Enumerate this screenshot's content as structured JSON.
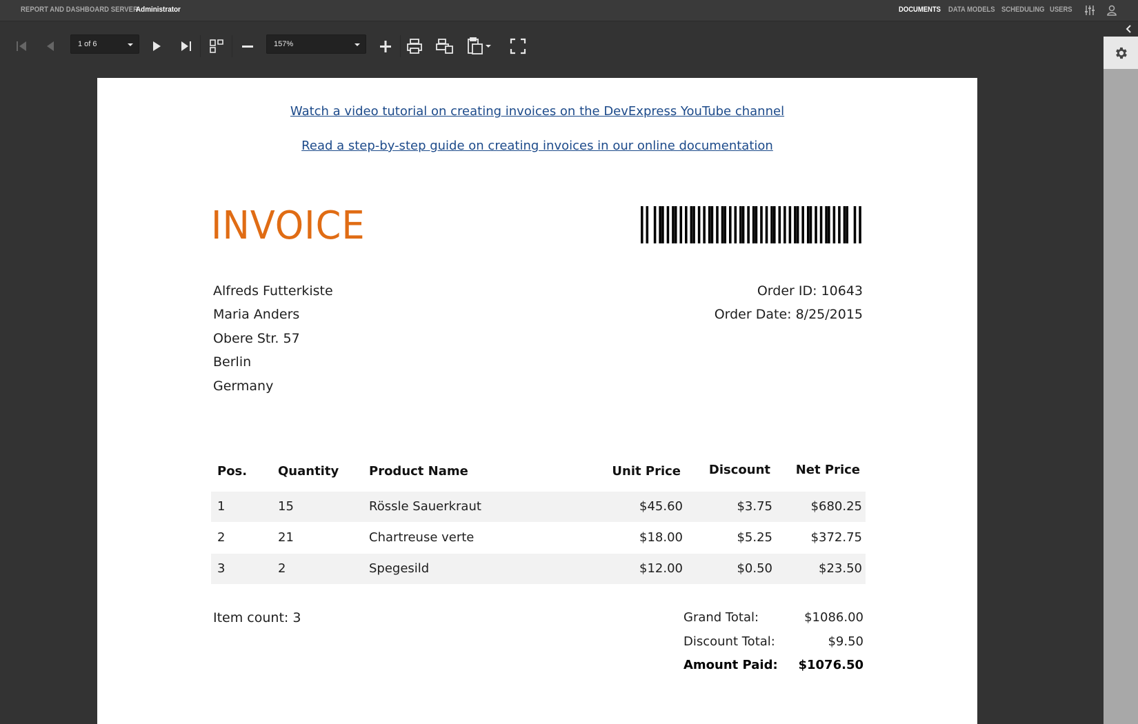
{
  "app": {
    "title": "REPORT AND DASHBOARD SERVER",
    "user": "Administrator",
    "nav": [
      "DOCUMENTS",
      "DATA MODELS",
      "SCHEDULING",
      "USERS"
    ],
    "active_nav": "DOCUMENTS"
  },
  "toolbar": {
    "page_selector": "1 of 6",
    "zoom": "157%",
    "buttons": [
      "first-page-icon",
      "prev-page-icon",
      "next-page-icon",
      "last-page-icon",
      "multipage-toggle-icon",
      "zoom-out-icon",
      "zoom-in-icon",
      "print-icon",
      "print-page-icon",
      "export-icon",
      "fullscreen-icon"
    ]
  },
  "document": {
    "links": [
      "Watch a video tutorial on creating invoices on the DevExpress YouTube channel",
      "Read a step-by-step guide on creating invoices in our online documentation"
    ],
    "title": "INVOICE",
    "barcode_bars": [
      1,
      0,
      1,
      0,
      0,
      1,
      0,
      1,
      1,
      0,
      1,
      0,
      1,
      1,
      0,
      1,
      0,
      1,
      0,
      1,
      1,
      0,
      1,
      0,
      1,
      0,
      1,
      1,
      0,
      1,
      0,
      1,
      1,
      0,
      1,
      0,
      1,
      0,
      1,
      1,
      0,
      1,
      0,
      1,
      1,
      0,
      1,
      0,
      1,
      0,
      1,
      1,
      0,
      1,
      0,
      1,
      0,
      1,
      0,
      1,
      1,
      0,
      1,
      0,
      1,
      1,
      0,
      1,
      0,
      1,
      0,
      1,
      1,
      0,
      1,
      0,
      1,
      0,
      1,
      1,
      0,
      0,
      1,
      0,
      1
    ],
    "customer": {
      "company": "Alfreds Futterkiste",
      "contact": "Maria Anders",
      "street": "Obere Str. 57",
      "city": "Berlin",
      "country": "Germany"
    },
    "order": {
      "id": "Order ID: 10643",
      "date": "Order Date: 8/25/2015"
    },
    "table": {
      "headers": {
        "pos": "Pos.",
        "quantity": "Quantity",
        "product": "Product Name",
        "unit_price": "Unit Price",
        "discount": "Discount",
        "net_price": "Net Price"
      },
      "rows": [
        {
          "pos": "1",
          "quantity": "15",
          "product": "Rössle Sauerkraut",
          "unit_price": "$45.60",
          "discount": "$3.75",
          "net_price": "$680.25"
        },
        {
          "pos": "2",
          "quantity": "21",
          "product": "Chartreuse verte",
          "unit_price": "$18.00",
          "discount": "$5.25",
          "net_price": "$372.75"
        },
        {
          "pos": "3",
          "quantity": "2",
          "product": "Spegesild",
          "unit_price": "$12.00",
          "discount": "$0.50",
          "net_price": "$23.50"
        }
      ]
    },
    "summary": {
      "item_count": "Item count: 3",
      "grand_total_label": "Grand Total:",
      "grand_total": "$1086.00",
      "discount_total_label": "Discount Total:",
      "discount_total": "$9.50",
      "amount_paid_label": "Amount Paid:",
      "amount_paid": "$1076.50"
    }
  }
}
